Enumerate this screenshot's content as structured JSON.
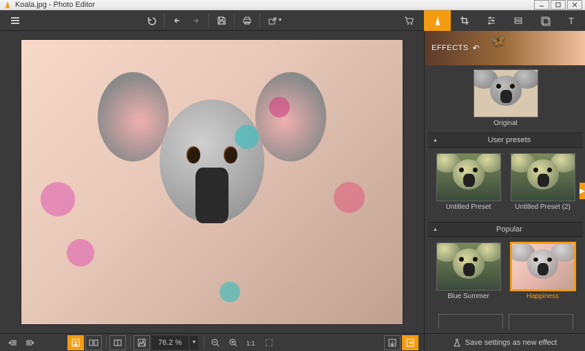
{
  "window": {
    "title": "Koala.jpg - Photo Editor",
    "min_label": "–",
    "max_label": "▢",
    "close_label": "✕"
  },
  "tooltabs": [
    "effects",
    "crop",
    "adjust",
    "layers",
    "frames",
    "text"
  ],
  "effects": {
    "title": "EFFECTS",
    "original_label": "Original",
    "sections": {
      "user_presets": {
        "label": "User presets",
        "items": [
          {
            "label": "Untitled Preset",
            "style": "filt-a"
          },
          {
            "label": "Untitled Preset (2)",
            "style": "filt-a"
          }
        ]
      },
      "popular": {
        "label": "Popular",
        "items": [
          {
            "label": "Blue Summer",
            "style": "filt-a",
            "selected": false
          },
          {
            "label": "Happiness",
            "style": "filt-b",
            "selected": true
          }
        ]
      }
    },
    "footer_label": "Save settings as new effect"
  },
  "viewer": {
    "zoom": "76.2 %"
  }
}
